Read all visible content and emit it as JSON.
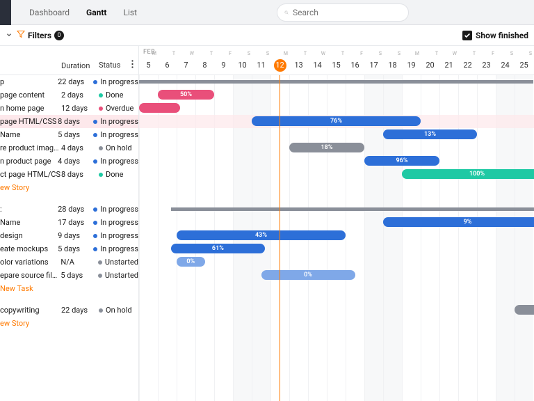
{
  "tabs": {
    "dashboard": "Dashboard",
    "gantt": "Gantt",
    "list": "List"
  },
  "search": {
    "placeholder": "Search"
  },
  "filters": {
    "label": "Filters",
    "count": "0"
  },
  "showFinished": "Show finished",
  "columns": {
    "duration": "Duration",
    "status": "Status"
  },
  "month": "FEB",
  "days": [
    {
      "n": "5",
      "w": "M"
    },
    {
      "n": "6",
      "w": "T"
    },
    {
      "n": "7",
      "w": "W"
    },
    {
      "n": "8",
      "w": "T"
    },
    {
      "n": "9",
      "w": "F"
    },
    {
      "n": "10",
      "w": "S"
    },
    {
      "n": "11",
      "w": "S"
    },
    {
      "n": "12",
      "w": "M"
    },
    {
      "n": "13",
      "w": "T"
    },
    {
      "n": "14",
      "w": "W"
    },
    {
      "n": "15",
      "w": "T"
    },
    {
      "n": "16",
      "w": "F"
    },
    {
      "n": "17",
      "w": "S"
    },
    {
      "n": "18",
      "w": "S"
    },
    {
      "n": "19",
      "w": "M"
    },
    {
      "n": "20",
      "w": "T"
    },
    {
      "n": "21",
      "w": "W"
    },
    {
      "n": "22",
      "w": "T"
    },
    {
      "n": "23",
      "w": "F"
    },
    {
      "n": "24",
      "w": "S"
    },
    {
      "n": "25",
      "w": "S"
    }
  ],
  "statusColors": {
    "In progress": "#2d6fd8",
    "Done": "#1fc9a4",
    "Overdue": "#e94f7a",
    "On hold": "#8a8f99",
    "Unstarted": "#8a8f99"
  },
  "rows": [
    {
      "name": "p",
      "dur": "22 days",
      "status": "In progress",
      "bar": {
        "type": "summary",
        "start": 0,
        "span": 21
      }
    },
    {
      "name": "page content",
      "dur": "2 days",
      "status": "Done",
      "bar": {
        "color": "pink",
        "start": 1,
        "span": 3,
        "pct": "50%"
      }
    },
    {
      "name": "n home page",
      "dur": "12 days",
      "status": "Overdue",
      "bar": {
        "color": "pink",
        "start": 0,
        "span": 2.2
      }
    },
    {
      "name": "page HTML/CSS",
      "dur": "8 days",
      "status": "In progress",
      "highlight": true,
      "bar": {
        "color": "blue",
        "start": 6,
        "span": 9,
        "pct": "76%"
      }
    },
    {
      "name": "Name",
      "dur": "5 days",
      "status": "In progress",
      "bar": {
        "color": "blue",
        "start": 13,
        "span": 5,
        "pct": "13%"
      }
    },
    {
      "name": "re product images",
      "dur": "4 days",
      "status": "On hold",
      "bar": {
        "color": "grey",
        "start": 8,
        "span": 4,
        "pct": "18%"
      }
    },
    {
      "name": "n product page",
      "dur": "4 days",
      "status": "In progress",
      "bar": {
        "color": "blue",
        "start": 12,
        "span": 4,
        "pct": "96%"
      }
    },
    {
      "name": "ct page HTML/CS",
      "dur": "8 days",
      "status": "Done",
      "bar": {
        "color": "teal",
        "start": 14,
        "span": 8,
        "pct": "100%"
      }
    },
    {
      "type": "link",
      "label": "ew Story"
    },
    {
      "type": "gap"
    },
    {
      "name": ":",
      "dur": "28 days",
      "status": "In progress",
      "bar": {
        "type": "summary",
        "start": 1.7,
        "span": 20
      }
    },
    {
      "name": "Name",
      "dur": "17 days",
      "status": "In progress",
      "bar": {
        "color": "blue",
        "start": 13,
        "span": 9,
        "pct": "9%"
      }
    },
    {
      "name": "design",
      "dur": "9 days",
      "status": "In progress",
      "bar": {
        "color": "blue",
        "start": 2,
        "span": 9,
        "pct": "43%"
      }
    },
    {
      "name": "eate mockups",
      "dur": "5 days",
      "status": "In progress",
      "bar": {
        "color": "blue",
        "start": 1.7,
        "span": 5,
        "pct": "61%"
      }
    },
    {
      "name": "olor variations",
      "dur": "N/A",
      "status": "Unstarted",
      "bar": {
        "color": "lblue",
        "start": 2,
        "span": 1.5,
        "pct": "0%"
      }
    },
    {
      "name": "epare source files for p...",
      "dur": "5 days",
      "status": "Unstarted",
      "bar": {
        "color": "lblue",
        "start": 6.5,
        "span": 5,
        "pct": "0%"
      }
    },
    {
      "type": "link",
      "label": "New Task"
    },
    {
      "type": "gap"
    },
    {
      "name": "copywriting",
      "dur": "22 days",
      "status": "On hold",
      "bar": {
        "color": "grey",
        "start": 20,
        "span": 2
      }
    },
    {
      "type": "link",
      "label": "ew Story"
    }
  ]
}
